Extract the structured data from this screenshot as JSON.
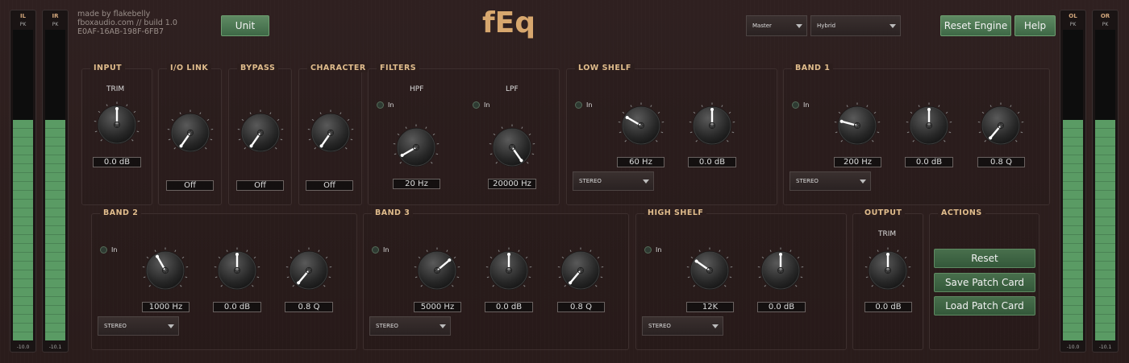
{
  "header": {
    "info_line1": "made by flakebelly",
    "info_line2": "fboxaudio.com // build 1.0",
    "info_line3": "E0AF-16AB-198F-6FB7",
    "unit_label": "Unit",
    "title": "fEq",
    "master_select": "Master",
    "mode_select": "Hybrid",
    "reset_engine_label": "Reset Engine",
    "help_label": "Help"
  },
  "meters": [
    {
      "label": "IL",
      "pk": "PK",
      "value": "-10.0",
      "level": 0.71
    },
    {
      "label": "IR",
      "pk": "PK",
      "value": "-10.1",
      "level": 0.71
    },
    {
      "label": "OL",
      "pk": "PK",
      "value": "-10.0",
      "level": 0.71
    },
    {
      "label": "OR",
      "pk": "PK",
      "value": "-10.1",
      "level": 0.71
    }
  ],
  "in_label": "In",
  "stereo_label": "STEREO",
  "input": {
    "title": "INPUT",
    "sub": "TRIM",
    "value": "0.0 dB"
  },
  "iolink": {
    "title": "I/O LINK",
    "value": "Off"
  },
  "bypass": {
    "title": "BYPASS",
    "value": "Off"
  },
  "character": {
    "title": "CHARACTER",
    "value": "Off"
  },
  "filters": {
    "title": "FILTERS",
    "hpf_label": "HPF",
    "lpf_label": "LPF",
    "hpf_value": "20 Hz",
    "lpf_value": "20000 Hz"
  },
  "lowshelf": {
    "title": "LOW SHELF",
    "freq": "60 Hz",
    "gain": "0.0 dB"
  },
  "band1": {
    "title": "BAND 1",
    "freq": "200 Hz",
    "gain": "0.0 dB",
    "q": "0.8 Q"
  },
  "band2": {
    "title": "BAND 2",
    "freq": "1000 Hz",
    "gain": "0.0 dB",
    "q": "0.8 Q"
  },
  "band3": {
    "title": "BAND 3",
    "freq": "5000 Hz",
    "gain": "0.0 dB",
    "q": "0.8 Q"
  },
  "highshelf": {
    "title": "HIGH SHELF",
    "freq": "12K",
    "gain": "0.0 dB"
  },
  "output": {
    "title": "OUTPUT",
    "sub": "TRIM",
    "value": "0.0 dB"
  },
  "actions": {
    "title": "ACTIONS",
    "reset": "Reset",
    "save": "Save Patch Card",
    "load": "Load Patch Card"
  },
  "colors": {
    "accent_title": "#d7a76e",
    "button_green": "#4f7a54",
    "meter_green": "#5a9b64"
  }
}
